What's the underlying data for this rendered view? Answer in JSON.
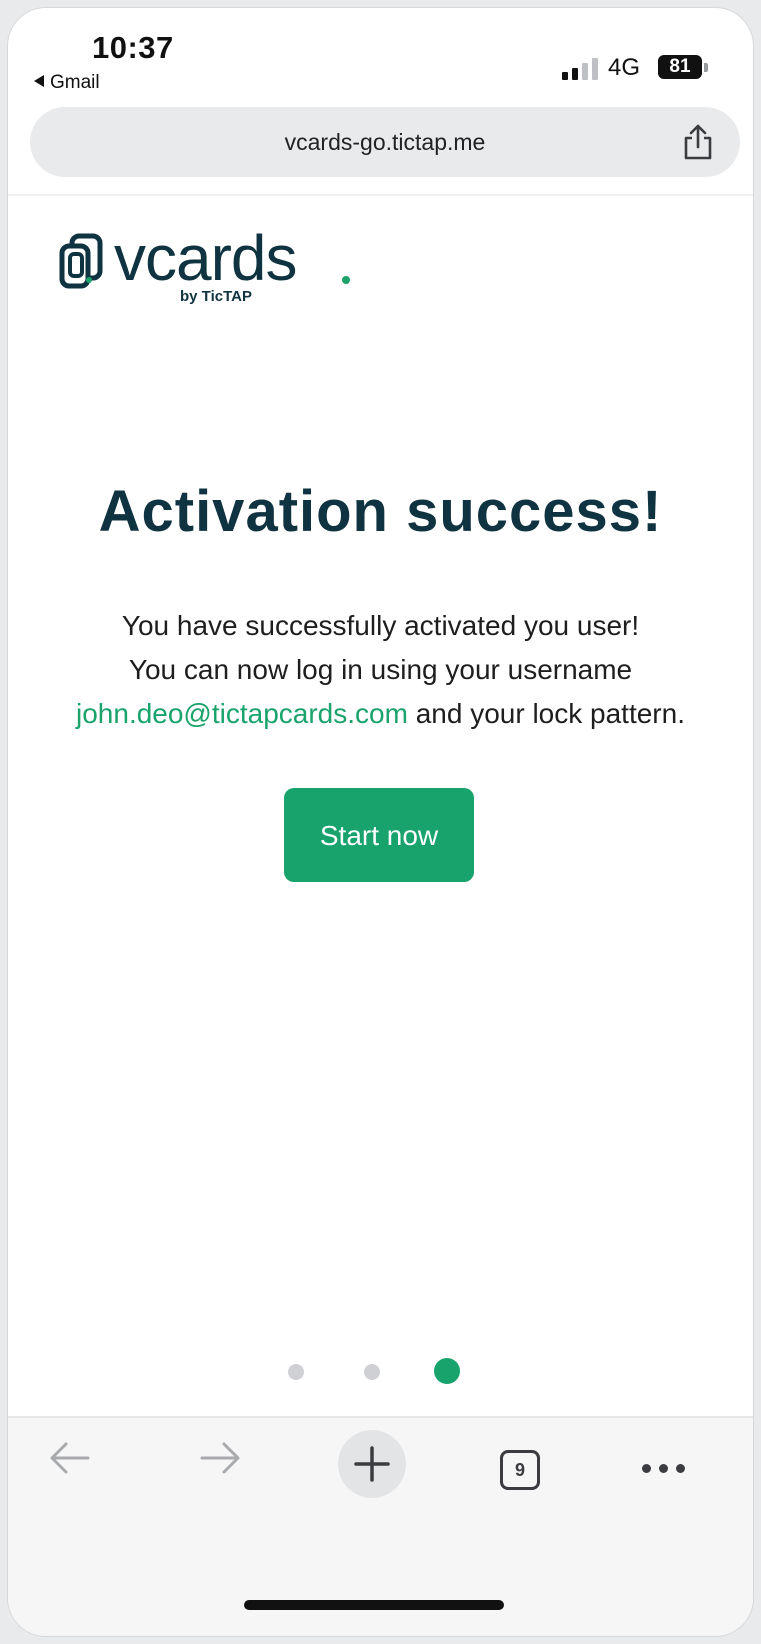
{
  "status_bar": {
    "time": "10:37",
    "back_app": "Gmail",
    "network": "4G",
    "battery": "81"
  },
  "browser": {
    "url": "vcards-go.tictap.me"
  },
  "logo": {
    "word": "vcards",
    "sub": "by TicTAP"
  },
  "content": {
    "heading": "Activation success!",
    "line1": "You have successfully activated you user!",
    "line2": "You can now log in using your username",
    "email": "john.deo@tictapcards.com",
    "line3_suffix": " and your lock pattern.",
    "start_button": "Start now"
  },
  "pagination": {
    "total": 3,
    "active_index": 2
  },
  "toolbar": {
    "tabs_count": "9"
  },
  "colors": {
    "brand_green": "#18a36d",
    "heading_navy": "#0f3340"
  }
}
